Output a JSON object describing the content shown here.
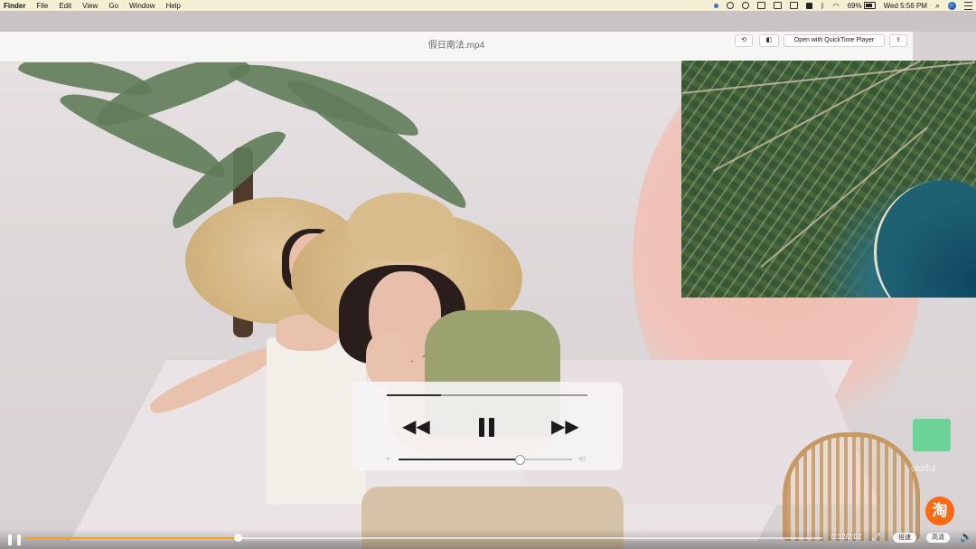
{
  "menubar": {
    "app_name": "Finder",
    "menus": [
      "File",
      "Edit",
      "View",
      "Go",
      "Window",
      "Help"
    ],
    "battery_percent": "69%",
    "clock": "Wed 5:56 PM",
    "status_icons": [
      "blue-dot-icon",
      "wechat-icon",
      "chat-icon",
      "screen-icon",
      "airplay-icon",
      "display-icon",
      "grid-icon",
      "bluetooth-icon",
      "wifi-icon",
      "battery-icon",
      "search-icon",
      "siri-icon",
      "menu-list-icon"
    ]
  },
  "window": {
    "title": "假日南法.mp4",
    "open_with_label": "Open with QuickTime Player",
    "toolbar_icons": [
      "rotate-icon",
      "trim-icon",
      "share-icon"
    ]
  },
  "hud": {
    "progress_fraction": 0.27,
    "volume_fraction": 0.7,
    "icons": [
      "rewind-icon",
      "pause-icon",
      "fast-forward-icon"
    ]
  },
  "player_bar": {
    "elapsed": "0:32",
    "duration": "2:02",
    "time_display": "0:32/2:02",
    "progress_fraction": 0.267,
    "speed_label": "倍速",
    "quality_label": "高清",
    "icons": [
      "pause-icon",
      "fullscreen-icon",
      "volume-icon"
    ],
    "accent_color": "#f5a418"
  },
  "side": {
    "text": "olorful",
    "taobao_char": "淘"
  }
}
